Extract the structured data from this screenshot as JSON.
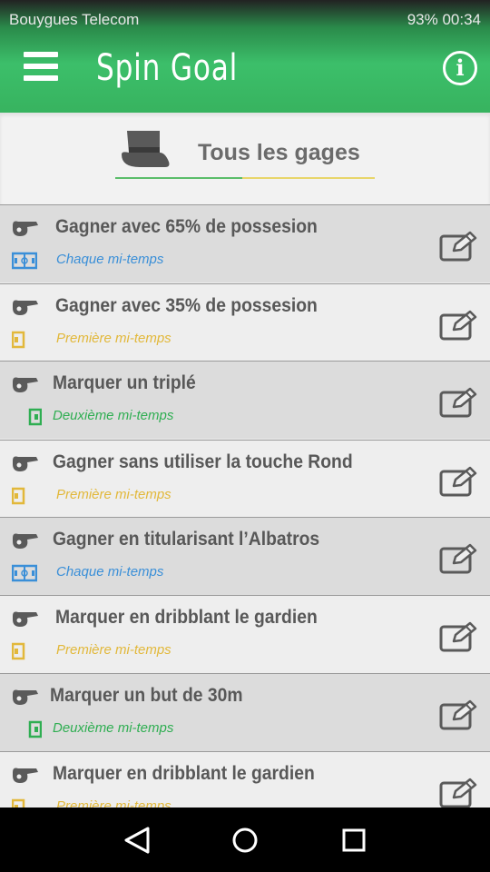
{
  "statusbar": {
    "carrier": "Bouygues Telecom",
    "battery_time": "93% 00:34"
  },
  "appbar": {
    "title": "Spin Goal",
    "info": "i"
  },
  "filter": {
    "label": "Tous les gages"
  },
  "colors": {
    "chaque": "#3a8fd8",
    "premiere": "#e2b83a",
    "deuxieme": "#2fae52"
  },
  "icons": {
    "menu": "menu-icon",
    "info": "info-icon",
    "hat": "hat-icon",
    "whistle": "whistle-icon",
    "edit": "edit-icon",
    "field": "field-icon"
  },
  "items": [
    {
      "title": "Gagner avec 65% de possesion",
      "period": "Chaque mi-temps"
    },
    {
      "title": "Gagner avec 35% de possesion",
      "period": "Première mi-temps"
    },
    {
      "title": "Marquer un triplé",
      "period": "Deuxième mi-temps"
    },
    {
      "title": "Gagner sans utiliser la touche Rond",
      "period": "Première mi-temps"
    },
    {
      "title": "Gagner en titularisant l’Albatros",
      "period": "Chaque mi-temps"
    },
    {
      "title": "Marquer en dribblant le gardien",
      "period": "Première mi-temps"
    },
    {
      "title": "Marquer un but de 30m",
      "period": "Deuxième mi-temps"
    },
    {
      "title": "Marquer en dribblant le gardien",
      "period": "Première mi-temps"
    }
  ]
}
